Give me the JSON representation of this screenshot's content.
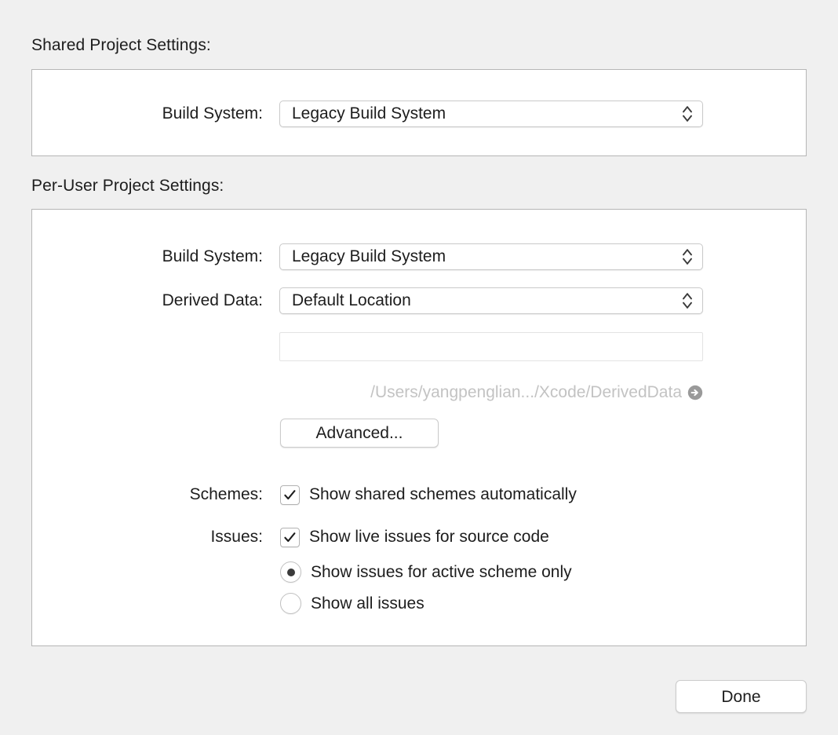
{
  "shared": {
    "heading": "Shared Project Settings:",
    "build_system": {
      "label": "Build System:",
      "value": "Legacy Build System"
    }
  },
  "per_user": {
    "heading": "Per-User Project Settings:",
    "build_system": {
      "label": "Build System:",
      "value": "Legacy Build System"
    },
    "derived_data": {
      "label": "Derived Data:",
      "value": "Default Location",
      "custom_path_value": "",
      "resolved_path": "/Users/yangpenglian.../Xcode/DerivedData",
      "reveal_icon": "arrow-right-circle-icon"
    },
    "advanced_button": "Advanced...",
    "schemes": {
      "label": "Schemes:",
      "checkbox_label": "Show shared schemes automatically",
      "checked": true
    },
    "issues": {
      "label": "Issues:",
      "live_issues_label": "Show live issues for source code",
      "live_issues_checked": true,
      "scope_options": [
        {
          "label": "Show issues for active scheme only",
          "selected": true
        },
        {
          "label": "Show all issues",
          "selected": false
        }
      ]
    }
  },
  "footer": {
    "done_label": "Done"
  },
  "icons": {
    "popup_chevrons": "chevron-up-down-icon",
    "checkmark": "checkmark-icon"
  },
  "colors": {
    "page_background": "#f0f0f0",
    "box_background": "#ffffff",
    "box_border": "#b6b6b6",
    "text": "#1d1d1d",
    "muted_text": "#c3c3c3",
    "control_border": "#c9c9c9"
  }
}
